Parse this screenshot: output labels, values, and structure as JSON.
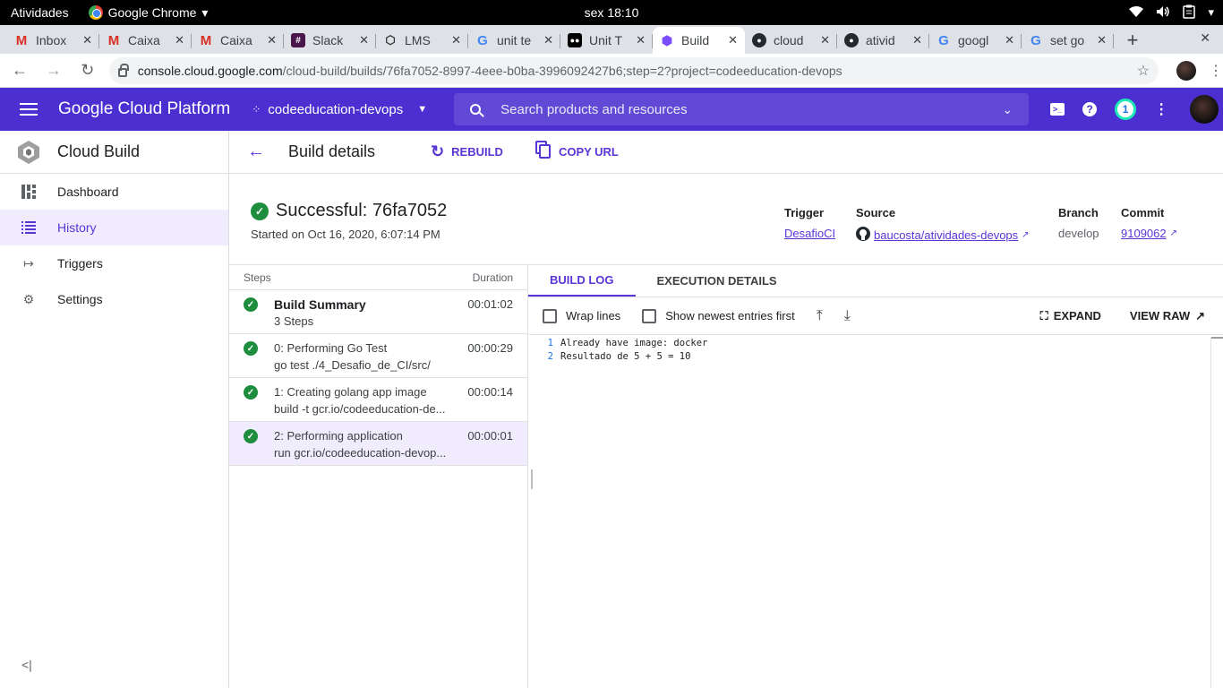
{
  "gnome": {
    "activities": "Atividades",
    "app_name": "Google Chrome",
    "clock": "sex 18:10"
  },
  "tabs": [
    {
      "title": "Inbox",
      "favicon": "gmail-icon"
    },
    {
      "title": "Caixa",
      "favicon": "gmail-icon"
    },
    {
      "title": "Caixa",
      "favicon": "gmail-icon"
    },
    {
      "title": "Slack",
      "favicon": "slack-icon"
    },
    {
      "title": "LMS",
      "favicon": "lms-icon"
    },
    {
      "title": "unit te",
      "favicon": "google-icon"
    },
    {
      "title": "Unit T",
      "favicon": "medium-icon"
    },
    {
      "title": "Build",
      "favicon": "cloud-build-icon",
      "active": true
    },
    {
      "title": "cloud",
      "favicon": "github-icon"
    },
    {
      "title": "ativid",
      "favicon": "github-icon"
    },
    {
      "title": "googl",
      "favicon": "google-icon"
    },
    {
      "title": "set go",
      "favicon": "google-icon"
    }
  ],
  "address": {
    "host": "console.cloud.google.com",
    "path": "/cloud-build/builds/76fa7052-8997-4eee-b0ba-3996092427b6;step=2?project=codeeducation-devops"
  },
  "gcp": {
    "title": "Google Cloud Platform",
    "project": "codeeducation-devops",
    "search_placeholder": "Search products and resources",
    "notifications": "1"
  },
  "sidebar": {
    "product": "Cloud Build",
    "items": [
      {
        "label": "Dashboard",
        "icon": "dashboard-icon"
      },
      {
        "label": "History",
        "icon": "list-icon",
        "active": true
      },
      {
        "label": "Triggers",
        "icon": "triggers-icon"
      },
      {
        "label": "Settings",
        "icon": "gear-icon"
      }
    ]
  },
  "page": {
    "title": "Build details",
    "rebuild": "REBUILD",
    "copy_url": "COPY URL"
  },
  "build": {
    "status": "Successful: 76fa7052",
    "started": "Started on Oct 16, 2020, 6:07:14 PM",
    "trigger_label": "Trigger",
    "trigger_value": "DesafioCI",
    "source_label": "Source",
    "source_value": "baucosta/atividades-devops",
    "branch_label": "Branch",
    "branch_value": "develop",
    "commit_label": "Commit",
    "commit_value": "9109062"
  },
  "steps": {
    "header_steps": "Steps",
    "header_duration": "Duration",
    "rows": [
      {
        "name": "Build Summary",
        "sub": "3 Steps",
        "duration": "00:01:02"
      },
      {
        "name": "0: Performing Go Test",
        "sub": "go test ./4_Desafio_de_CI/src/",
        "duration": "00:00:29"
      },
      {
        "name": "1: Creating golang app image",
        "sub": "build -t gcr.io/codeeducation-de...",
        "duration": "00:00:14"
      },
      {
        "name": "2: Performing application",
        "sub": "run gcr.io/codeeducation-devop...",
        "duration": "00:00:01"
      }
    ]
  },
  "log": {
    "tab_build_log": "BUILD LOG",
    "tab_execution": "EXECUTION DETAILS",
    "wrap_lines": "Wrap lines",
    "newest_first": "Show newest entries first",
    "expand": "EXPAND",
    "view_raw": "VIEW RAW",
    "lines": [
      {
        "n": "1",
        "text": "Already have image: docker"
      },
      {
        "n": "2",
        "text": "Resultado de 5 + 5 = 10"
      }
    ]
  }
}
